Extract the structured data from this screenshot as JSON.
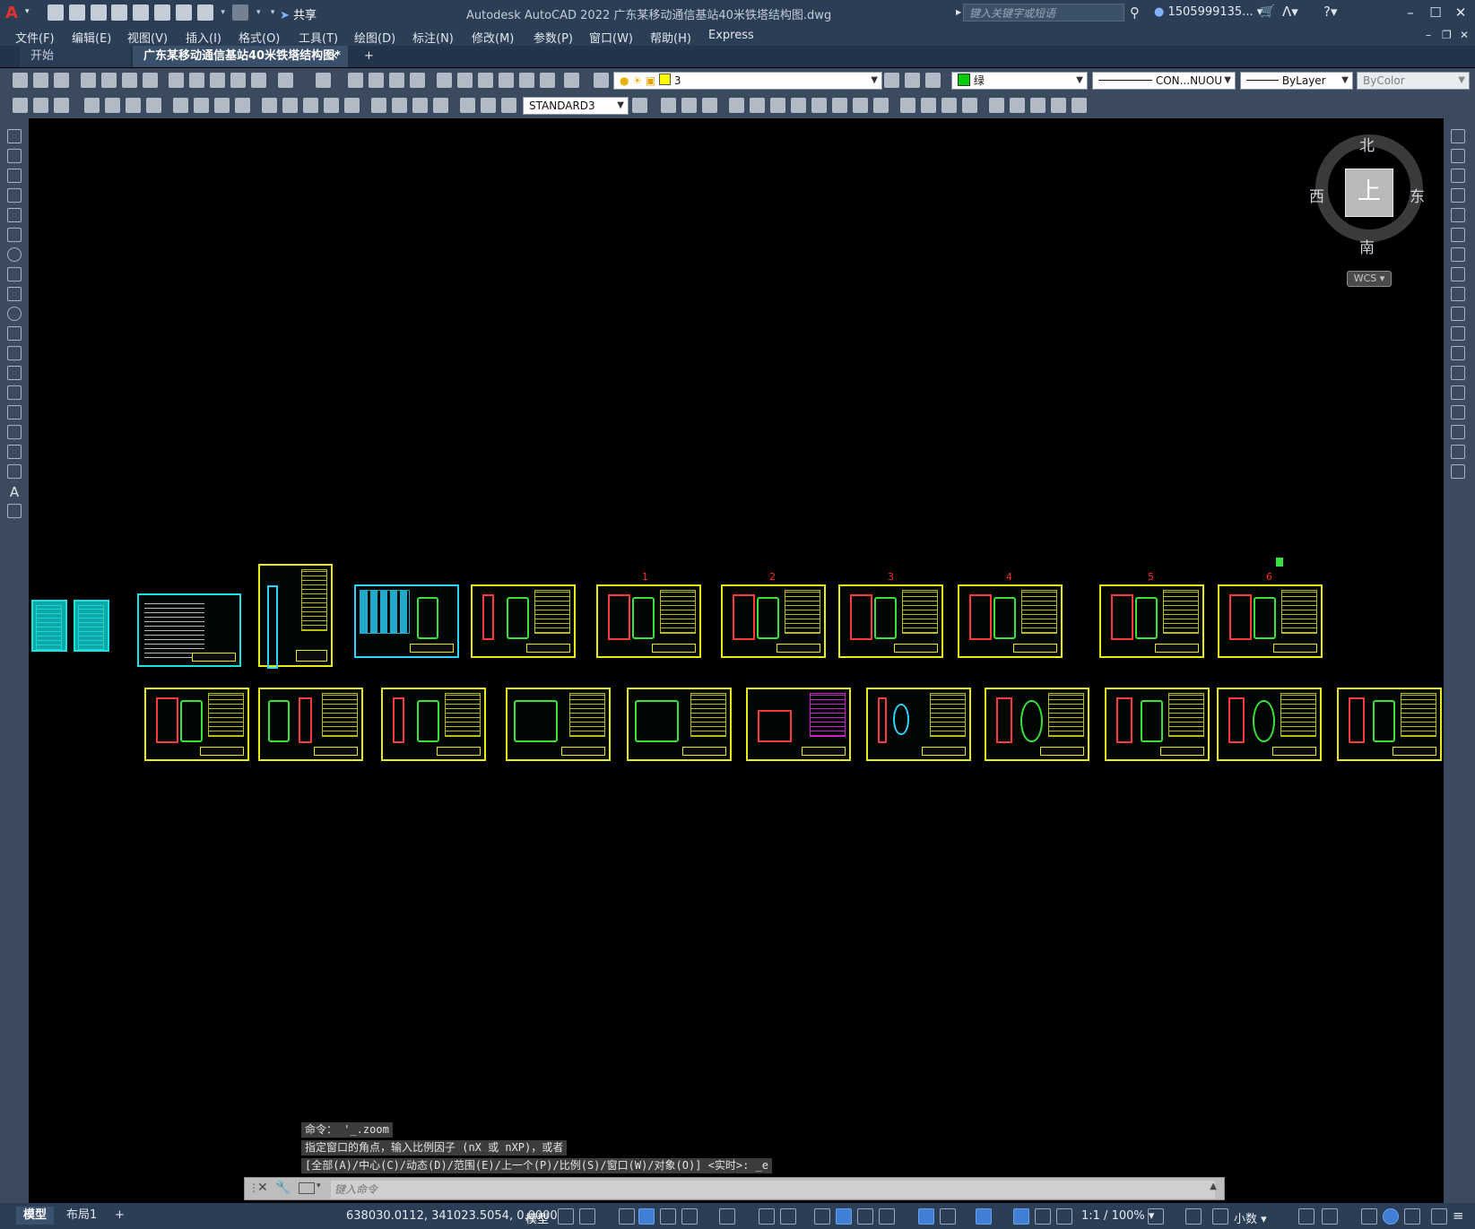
{
  "titlebar": {
    "share_label": "共享",
    "app_title": "Autodesk AutoCAD 2022    广东某移动通信基站40米铁塔结构图.dwg",
    "search_placeholder": "键入关键字或短语",
    "user": "1505999135...",
    "window_controls": [
      "minimize",
      "maximize",
      "close"
    ]
  },
  "menu": {
    "items": [
      "文件(F)",
      "编辑(E)",
      "视图(V)",
      "插入(I)",
      "格式(O)",
      "工具(T)",
      "绘图(D)",
      "标注(N)",
      "修改(M)",
      "参数(P)",
      "窗口(W)",
      "帮助(H)",
      "Express"
    ]
  },
  "tabs": {
    "start": "开始",
    "document": "广东某移动通信基站40米铁塔结构图*",
    "close_symbol": "×",
    "add_symbol": "+"
  },
  "toolbar": {
    "layer_value": "3",
    "color_value": "绿",
    "linetype_value": "CON...NUOU",
    "lineweight_value": "ByLayer",
    "plotstyle_value": "ByColor",
    "textstyle_value": "STANDARD3",
    "accent_green": "#00cc00",
    "accent_yellow": "#ffff00"
  },
  "viewcube": {
    "north": "北",
    "south": "南",
    "east": "东",
    "west": "西",
    "face": "上",
    "wcs": "WCS"
  },
  "drawing": {
    "sheet_numbers": [
      "1",
      "2",
      "3",
      "4",
      "5",
      "6"
    ],
    "sheet_count_row1": 12,
    "sheet_count_row2": 11
  },
  "command": {
    "history": [
      "命令： '_.zoom",
      "指定窗口的角点，输入比例因子 (nX 或 nXP)，或者",
      "[全部(A)/中心(C)/动态(D)/范围(E)/上一个(P)/比例(S)/窗口(W)/对象(O)] <实时>: _e"
    ],
    "placeholder": "键入命令"
  },
  "status": {
    "tab_model": "模型",
    "tab_layout": "布局1",
    "add_layout": "+",
    "coordinates": "638030.0112, 341023.5054, 0.0000",
    "model_label": "模型",
    "scale": "1:1 / 100%",
    "units": "小数"
  }
}
